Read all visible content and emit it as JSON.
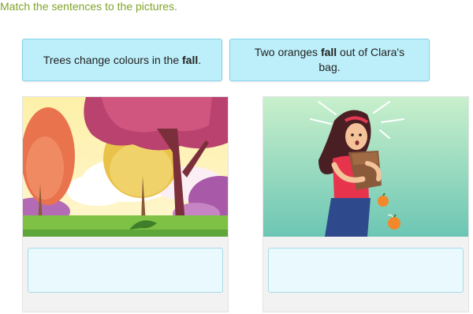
{
  "instruction": "Match the sentences to the pictures.",
  "cards": [
    {
      "before": "Trees change colours in the ",
      "bold": "fall",
      "after": "."
    },
    {
      "before": "Two oranges ",
      "bold": "fall",
      "after": " out of Clara's bag."
    }
  ],
  "pictures": [
    {
      "icon": "autumn-trees-illustration"
    },
    {
      "icon": "girl-dropping-oranges-illustration"
    }
  ],
  "colors": {
    "instruction": "#7fa42a",
    "card_bg": "#bdeffa",
    "card_border": "#86d2e6",
    "drop_bg": "#e9f9fd",
    "drop_border": "#a8dbe8"
  }
}
